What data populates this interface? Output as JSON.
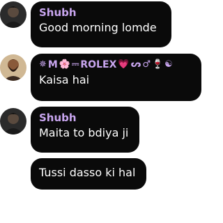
{
  "messages": [
    {
      "sender": "Shubh",
      "text": "Good morning lomde",
      "avatar": "dark-portrait-avatar"
    },
    {
      "sender_parts": {
        "lead_symbol": "✵",
        "initial": "M",
        "flower": "🌸",
        "dash": "⎓",
        "name": "ROLEX",
        "heart": "💗",
        "swirl": "ᔕ",
        "male_sign": "♂",
        "wine": "🍷",
        "trail": "☯"
      },
      "text": "Kaisa hai",
      "avatar": "bearded-man-avatar"
    },
    {
      "sender": "Shubh",
      "text": "Maita to bdiya ji",
      "avatar": "dark-portrait-avatar"
    },
    {
      "text": "Tussi dasso ki hal"
    }
  ],
  "colors": {
    "bubble_bg": "#0a0a0a",
    "sender_name": "#c9a6f0",
    "message_text": "#ffffff"
  }
}
